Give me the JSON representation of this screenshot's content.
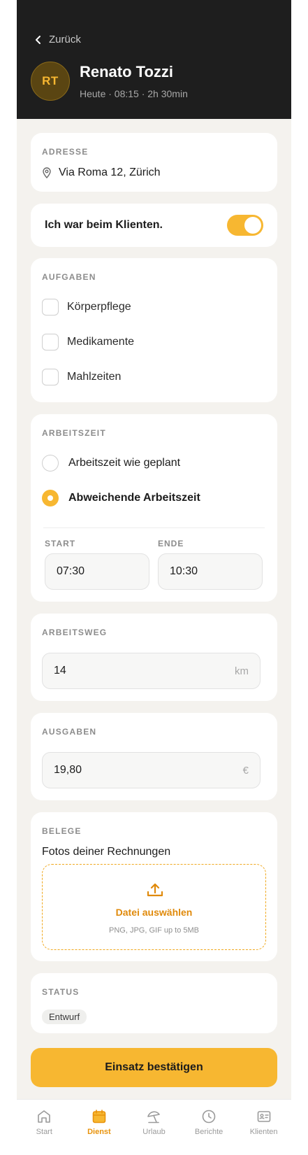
{
  "header": {
    "back_label": "Zurück",
    "avatar_initials": "RT",
    "client_name": "Renato Tozzi",
    "meta": "Heute · 08:15 · 2h 30min"
  },
  "address": {
    "label": "ADRESSE",
    "value": "Via Roma 12, Zürich"
  },
  "visited": {
    "label": "Ich war beim Klienten.",
    "on": true
  },
  "tasks": {
    "label": "AUFGABEN",
    "items": [
      {
        "label": "Körperpflege",
        "checked": false
      },
      {
        "label": "Medikamente",
        "checked": false
      },
      {
        "label": "Mahlzeiten",
        "checked": false
      }
    ]
  },
  "worktime": {
    "label": "ARBEITSZEIT",
    "options": [
      {
        "label": "Arbeitszeit wie geplant",
        "selected": false
      },
      {
        "label": "Abweichende Arbeitszeit",
        "selected": true
      }
    ],
    "start_label": "START",
    "start_value": "07:30",
    "end_label": "ENDE",
    "end_value": "10:30"
  },
  "commute": {
    "label": "ARBEITSWEG",
    "value": "14",
    "unit": "km"
  },
  "expenses": {
    "label": "AUSGABEN",
    "value": "19,80",
    "unit": "€"
  },
  "receipts": {
    "label": "BELEGE",
    "subtitle": "Fotos deiner Rechnungen",
    "upload_label": "Datei auswählen",
    "upload_hint": "PNG, JPG, GIF up to 5MB"
  },
  "status": {
    "label": "STATUS",
    "value": "Entwurf"
  },
  "confirm_label": "Einsatz bestätigen",
  "nav": {
    "items": [
      {
        "label": "Start"
      },
      {
        "label": "Dienst"
      },
      {
        "label": "Urlaub"
      },
      {
        "label": "Berichte"
      },
      {
        "label": "Klienten"
      }
    ]
  },
  "colors": {
    "accent": "#f7b731",
    "accent_text": "#e8930c",
    "header_bg": "#1e1e1e",
    "page_bg": "#f4f2ee"
  }
}
